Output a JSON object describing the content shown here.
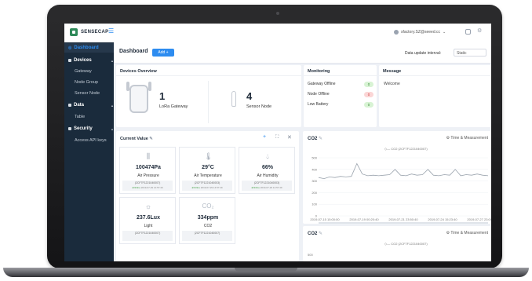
{
  "brand": {
    "name": "SENSECAP"
  },
  "topbar": {
    "user_email": "sfactory.SZ@seeed.cc"
  },
  "sidebar": {
    "dashboard": "Dashboard",
    "devices": "Devices",
    "gateway": "Gateway",
    "node_group": "Node Group",
    "sensor_node": "Sensor Node",
    "data": "Data",
    "table": "Table",
    "security": "Security",
    "api_keys": "Access API keys"
  },
  "header": {
    "title": "Dashboard",
    "add_label": "Add +",
    "interval_label": "Data update interval:",
    "interval_value": "Static"
  },
  "overview": {
    "title": "Devices Overview",
    "gateway_count": "1",
    "gateway_label": "LoRa Gateway",
    "node_count": "4",
    "node_label": "Sensor Node"
  },
  "monitoring": {
    "title": "Monitoring",
    "rows": [
      {
        "label": "Gateway Offline",
        "value": "0"
      },
      {
        "label": "Node Offline",
        "value": "0"
      },
      {
        "label": "Low Battery",
        "value": "0"
      }
    ]
  },
  "message": {
    "title": "Message",
    "text": "Welcome"
  },
  "current_value": {
    "title": "Current Value",
    "cards": [
      {
        "value": "100474Pa",
        "name": "Air Pressure",
        "id": "(2CF7F1221040007)",
        "status_ok": "●Online",
        "status_time": "2019-07-29 14:57:49"
      },
      {
        "value": "29°C",
        "name": "Air Temperature",
        "id": "(2CF7F1221040003)",
        "status_ok": "●Online",
        "status_time": "2019-07-29 14:57:49"
      },
      {
        "value": "66%",
        "name": "Air Humidity",
        "id": "(2CF7F1221040003)",
        "status_ok": "●Online",
        "status_time": "2019-07-29 14:57:49"
      },
      {
        "value": "237.6Lux",
        "name": "Light",
        "id": "(2CF7F1221040007)",
        "status_ok": "",
        "status_time": ""
      },
      {
        "value": "334ppm",
        "name": "CO2",
        "id": "(2CF7F1221040007)",
        "status_ok": "",
        "status_time": ""
      }
    ],
    "icons": {
      "co2": "CO₂"
    }
  },
  "chart1": {
    "title": "CO2",
    "right_label": "Time & Measurement",
    "legend": "CO2 (2CF7F1221040007)"
  },
  "chart2": {
    "title": "CO2",
    "right_label": "Time & Measurement",
    "legend": "CO2 (2CF7F1221040007)",
    "y_first_tick": "500"
  },
  "chart_data": {
    "type": "line",
    "title": "CO2",
    "series": [
      {
        "name": "CO2 (2CF7F1221040007)",
        "values": [
          330,
          320,
          335,
          330,
          340,
          335,
          340,
          450,
          360,
          345,
          350,
          345,
          350,
          355,
          400,
          350,
          345,
          360,
          350,
          355,
          400,
          350,
          345,
          355,
          350,
          400,
          345,
          355,
          350,
          360,
          350,
          345
        ]
      }
    ],
    "x_ticks": [
      "2019-07-15 15:00:00",
      "2019-07-19 00:20:40",
      "2019-07-21 23:50:40",
      "2019-07-24 15:23:40",
      "2019-07-27 23:00:00"
    ],
    "y_ticks": [
      0,
      100,
      200,
      300,
      400,
      500
    ],
    "ylim": [
      0,
      500
    ]
  },
  "colors": {
    "accent": "#2d8cf0",
    "sidebar": "#1a2b3c",
    "line": "#9aa3ad"
  }
}
